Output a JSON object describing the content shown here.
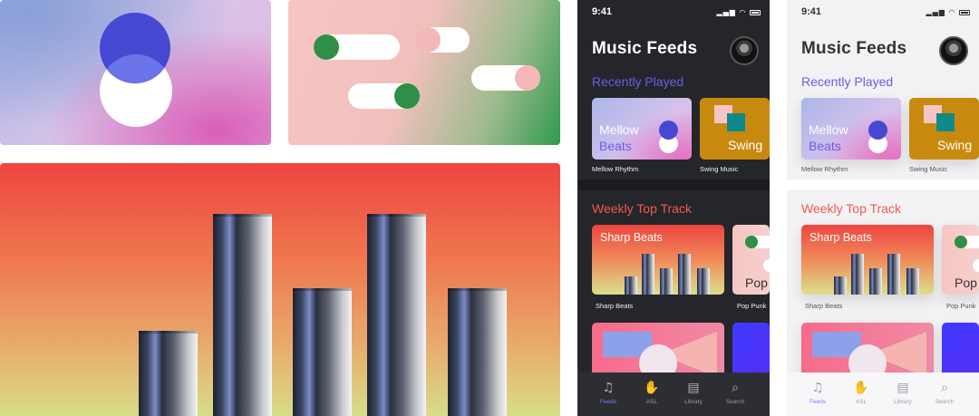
{
  "art": {
    "bars_panel": {
      "bars": [
        {
          "height_fraction": 0.24
        },
        {
          "height_fraction": 0.57
        },
        {
          "height_fraction": 0.36
        },
        {
          "height_fraction": 0.57
        },
        {
          "height_fraction": 0.36
        }
      ]
    }
  },
  "phones": [
    {
      "theme": "dark",
      "status": {
        "time": "9:41",
        "icons": "▂▄▆ ◠"
      },
      "title": "Music Feeds",
      "recently_played_heading": "Recently Played",
      "recent_cards": [
        {
          "line1": "Mellow",
          "line2": "Beats",
          "caption": "Mellow Rhythm"
        },
        {
          "label": "Swing",
          "caption": "Swing Music"
        }
      ],
      "weekly_heading": "Weekly Top Track",
      "weekly_cards": [
        {
          "title": "Sharp Beats",
          "caption": "Sharp Beats"
        },
        {
          "label": "Pop",
          "caption": "Pop Punk"
        }
      ],
      "tabs": [
        {
          "icon": "♫",
          "label": "Feeds"
        },
        {
          "icon": "✋",
          "label": "ASL"
        },
        {
          "icon": "▤",
          "label": "Library"
        },
        {
          "icon": "⌕",
          "label": "Search"
        }
      ]
    },
    {
      "theme": "light",
      "status": {
        "time": "9:41",
        "icons": "▂▄▆ ◠"
      },
      "title": "Music Feeds",
      "recently_played_heading": "Recently Played",
      "recent_cards": [
        {
          "line1": "Mellow",
          "line2": "Beats",
          "caption": "Mellow Rhythm"
        },
        {
          "label": "Swing",
          "caption": "Swing Music"
        }
      ],
      "weekly_heading": "Weekly Top Track",
      "weekly_cards": [
        {
          "title": "Sharp Beats",
          "caption": "Sharp Beats"
        },
        {
          "label": "Pop",
          "caption": "Pop Punk"
        }
      ],
      "tabs": [
        {
          "icon": "♫",
          "label": "Feeds"
        },
        {
          "icon": "✋",
          "label": "ASL"
        },
        {
          "icon": "▤",
          "label": "Library"
        },
        {
          "icon": "⌕",
          "label": "Search"
        }
      ]
    }
  ],
  "colors": {
    "accent_purple": "#6c5ce7",
    "accent_red": "#ef5a4c",
    "active_tab_icon": "#61d8c4"
  }
}
